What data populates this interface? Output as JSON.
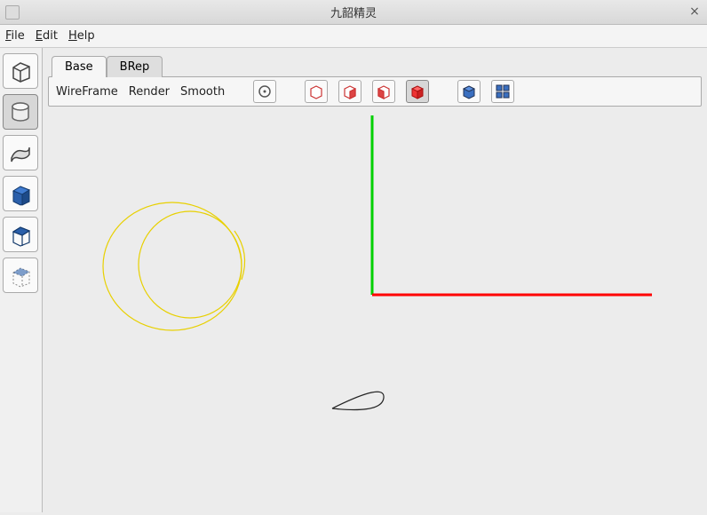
{
  "window": {
    "title": "九韶精灵"
  },
  "menu": {
    "file": "File",
    "edit": "Edit",
    "help": "Help"
  },
  "tabs": {
    "base": "Base",
    "brep": "BRep",
    "selected": "Base"
  },
  "toolbar": {
    "wireframe": "WireFrame",
    "render": "Render",
    "smooth": "Smooth"
  },
  "sidebar_icons": [
    "box-outline-icon",
    "cylinder-icon",
    "sheet-icon",
    "solid-cube-icon",
    "wire-cube-icon",
    "transparent-cube-icon"
  ],
  "toolbar_icons": [
    "target-icon",
    "cube-outline-icon",
    "cube-half-icon",
    "cube-face-icon",
    "cube-solid-icon",
    "cube-iso-icon",
    "components-icon"
  ]
}
